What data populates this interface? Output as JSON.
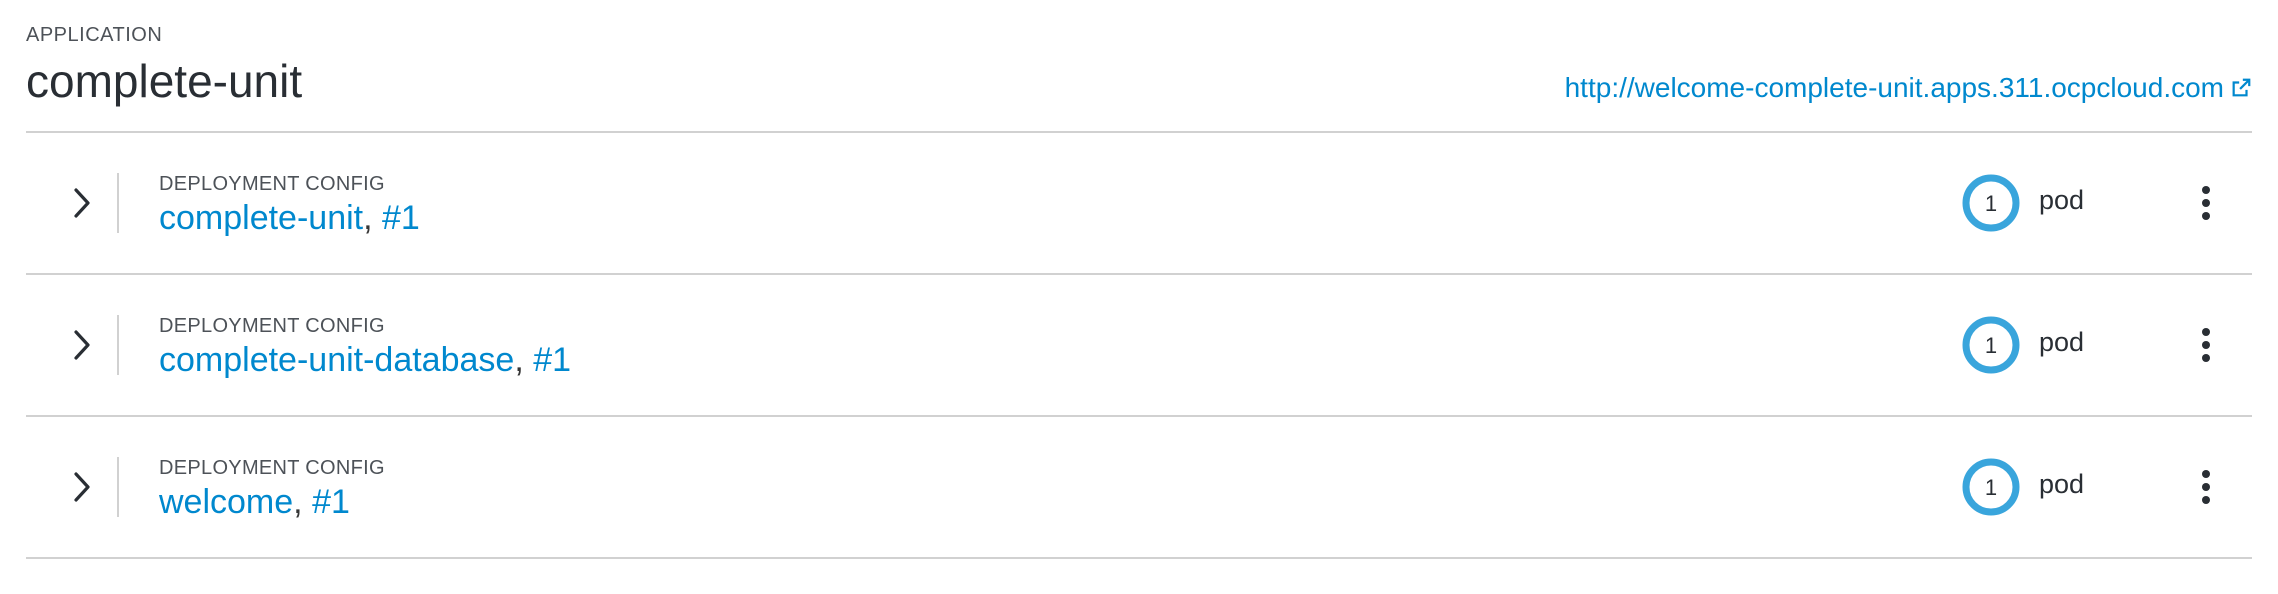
{
  "application": {
    "kicker": "APPLICATION",
    "title": "complete-unit",
    "route_url": "http://welcome-complete-unit.apps.311.ocpcloud.com"
  },
  "deployments": [
    {
      "kind": "DEPLOYMENT CONFIG",
      "name": "complete-unit",
      "separator": ",",
      "revision": "#1",
      "pod_count": "1",
      "pod_label": "pod"
    },
    {
      "kind": "DEPLOYMENT CONFIG",
      "name": "complete-unit-database",
      "separator": ",",
      "revision": "#1",
      "pod_count": "1",
      "pod_label": "pod"
    },
    {
      "kind": "DEPLOYMENT CONFIG",
      "name": "welcome",
      "separator": ",",
      "revision": "#1",
      "pod_count": "1",
      "pod_label": "pod"
    }
  ],
  "colors": {
    "link": "#0088ce",
    "pod_ring": "#39a5dc",
    "divider": "#d1d1d1"
  },
  "icons": {
    "expand": "chevron-right-icon",
    "external": "external-link-icon",
    "actions": "kebab-menu-icon"
  }
}
